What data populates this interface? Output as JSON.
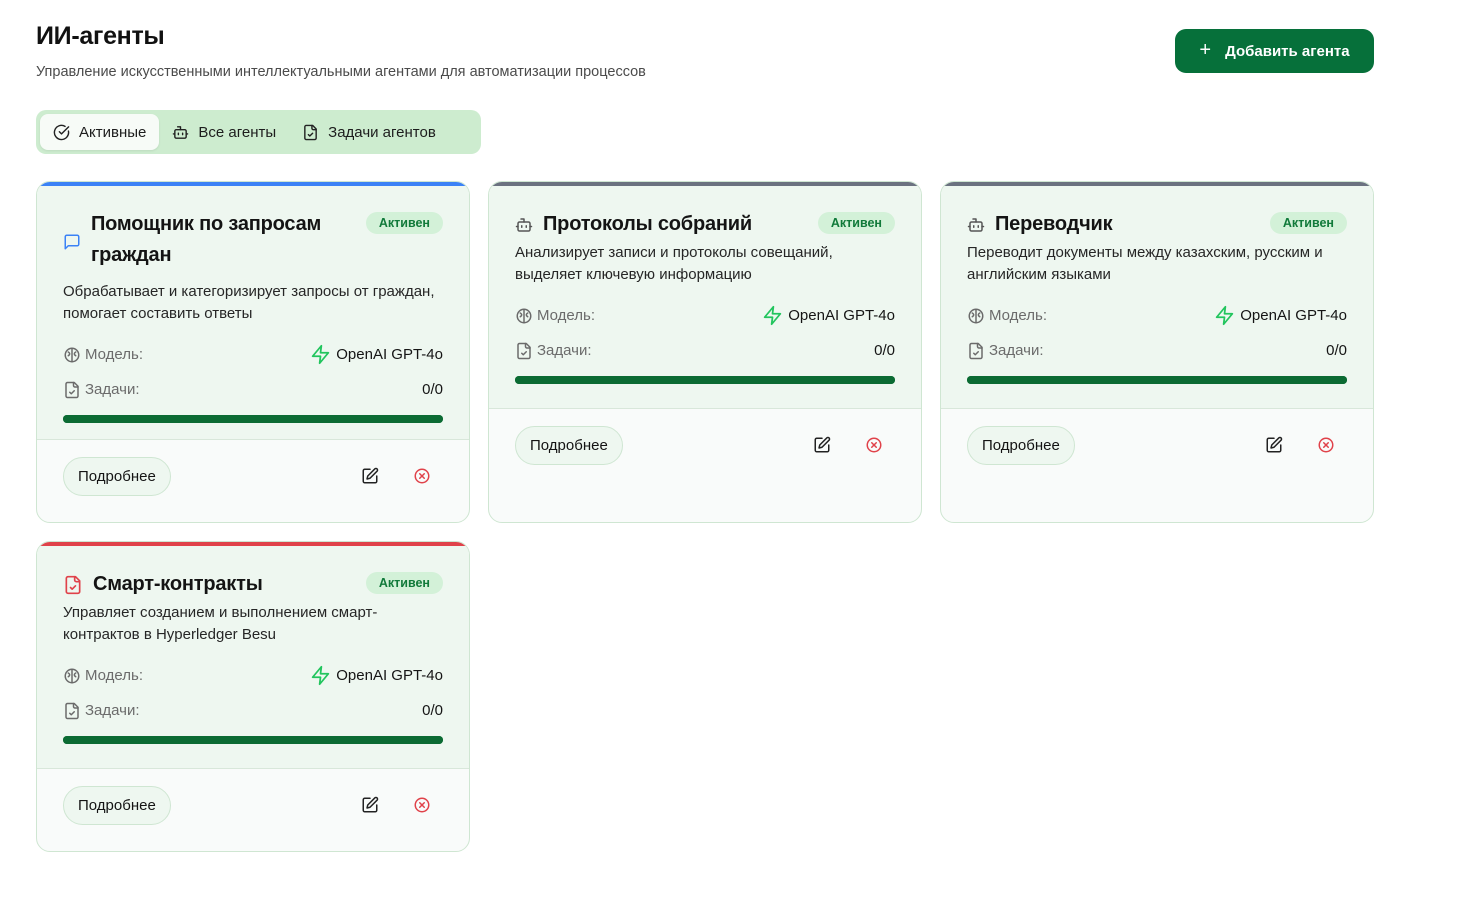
{
  "header": {
    "title": "ИИ-агенты",
    "subtitle": "Управление искусственными интеллектуальными агентами для автоматизации процессов",
    "add_button_label": "Добавить агента"
  },
  "tabs": [
    {
      "label": "Активные",
      "icon": "check-circle-icon",
      "active": true
    },
    {
      "label": "Все агенты",
      "icon": "bot-icon",
      "active": false
    },
    {
      "label": "Задачи агентов",
      "icon": "file-check-icon",
      "active": false
    }
  ],
  "labels": {
    "model": "Модель:",
    "tasks": "Задачи:",
    "details": "Подробнее"
  },
  "colors": {
    "accent": "#06703a",
    "blue": "#3b82f6",
    "gray": "#6b7280",
    "red": "#e0424a"
  },
  "cards": [
    {
      "title": "Помощник по запросам граждан",
      "status": "Активен",
      "description": "Обрабатывает и категоризирует запросы от граждан, помогает составить ответы",
      "model": "OpenAI GPT-4o",
      "tasks": "0/0",
      "progress": 1.0,
      "icon": "message-square-icon",
      "accent": "#3b82f6"
    },
    {
      "title": "Протоколы собраний",
      "status": "Активен",
      "description": "Анализирует записи и протоколы совещаний, выделяет ключевую информацию",
      "model": "OpenAI GPT-4o",
      "tasks": "0/0",
      "progress": 1.0,
      "icon": "bot-icon",
      "accent": "#6b7280"
    },
    {
      "title": "Переводчик",
      "status": "Активен",
      "description": "Переводит документы между казахским, русским и английским языками",
      "model": "OpenAI GPT-4o",
      "tasks": "0/0",
      "progress": 1.0,
      "icon": "bot-icon",
      "accent": "#6b7280"
    },
    {
      "title": "Смарт-контракты",
      "status": "Активен",
      "description": "Управляет созданием и выполнением смарт-контрактов в Hyperledger Besu",
      "model": "OpenAI GPT-4o",
      "tasks": "0/0",
      "progress": 1.0,
      "icon": "file-check-icon",
      "accent": "#e0424a"
    }
  ]
}
